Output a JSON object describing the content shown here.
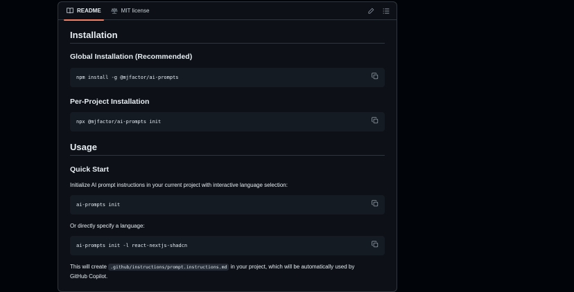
{
  "tabs": [
    {
      "label": "README",
      "icon": "book-icon",
      "active": true
    },
    {
      "label": "MIT license",
      "icon": "scale-icon",
      "active": false
    }
  ],
  "actions": {
    "edit_icon": "pencil-icon",
    "outline_icon": "list-icon"
  },
  "sections": {
    "installation_title": "Installation",
    "global_title": "Global Installation (Recommended)",
    "global_code": "npm install -g @mjfactor/ai-prompts",
    "perproject_title": "Per-Project Installation",
    "perproject_code": "npx @mjfactor/ai-prompts init",
    "usage_title": "Usage",
    "quickstart_title": "Quick Start",
    "quickstart_text": "Initialize AI prompt instructions in your current project with interactive language selection:",
    "quickstart_code": "ai-prompts init",
    "specify_text": "Or directly specify a language:",
    "specify_code": "ai-prompts init -l react-nextjs-shadcn",
    "create_text_before": "This will create ",
    "create_inline_code": ".github/instructions/prompt.instructions.md",
    "create_text_after": " in your project, which will be automatically used by",
    "create_text_line2": "GitHub Copilot."
  },
  "colors": {
    "accent_underline": "#f78166",
    "code_bg": "#151b23",
    "page_bg": "#0d1117"
  }
}
